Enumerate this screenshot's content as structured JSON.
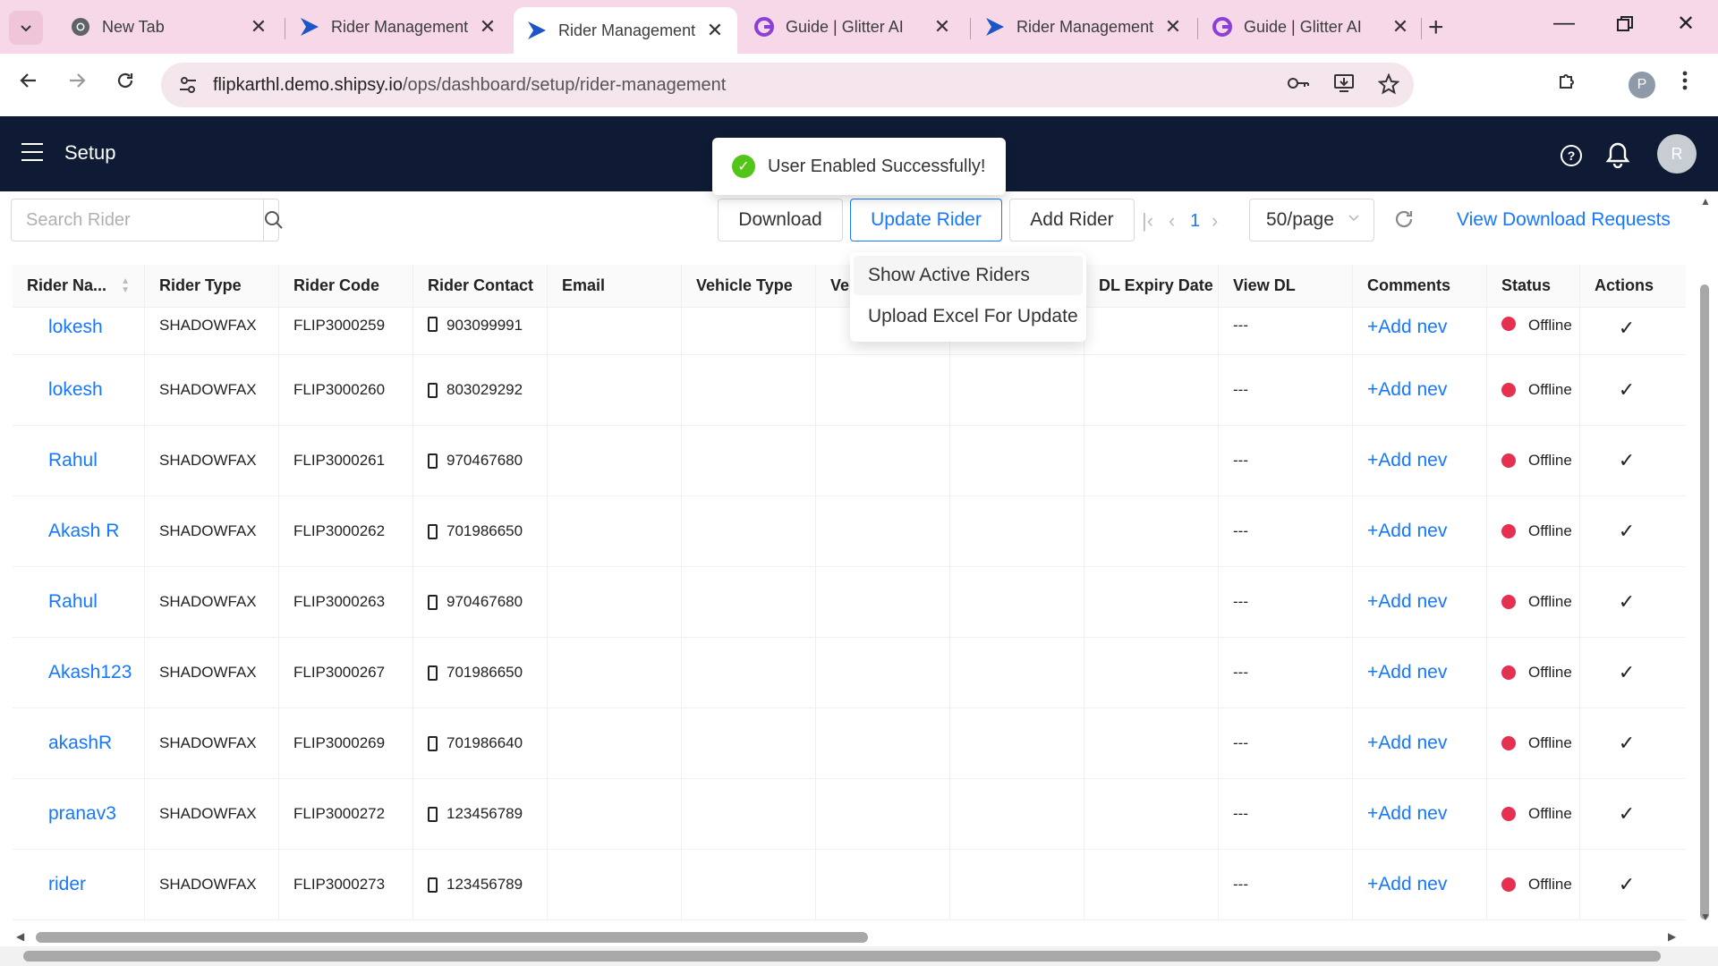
{
  "browser": {
    "tabs": [
      {
        "title": "New Tab",
        "icon": "chrome-icon",
        "active": false
      },
      {
        "title": "Rider Management",
        "icon": "shipsy-icon",
        "active": false
      },
      {
        "title": "Rider Management",
        "icon": "shipsy-icon",
        "active": true
      },
      {
        "title": "Guide | Glitter AI",
        "icon": "glitter-icon",
        "active": false
      },
      {
        "title": "Rider Management",
        "icon": "shipsy-icon",
        "active": false
      },
      {
        "title": "Guide | Glitter AI",
        "icon": "glitter-icon",
        "active": false
      }
    ],
    "url_host": "flipkarthl.demo.shipsy.io",
    "url_path": "/ops/dashboard/setup/rider-management",
    "profile_initial": "P"
  },
  "header": {
    "title": "Setup",
    "avatar_initial": "R"
  },
  "toast": {
    "message": "User Enabled Successfully!"
  },
  "toolbar": {
    "search_placeholder": "Search Rider",
    "download_label": "Download",
    "update_rider_label": "Update Rider",
    "add_rider_label": "Add Rider",
    "current_page": "1",
    "page_size": "50/page",
    "view_download_requests_label": "View Download Requests"
  },
  "dropdown": {
    "items": [
      "Show Active Riders",
      "Upload Excel For Update"
    ]
  },
  "table": {
    "columns": [
      "Rider Na...",
      "Rider Type",
      "Rider Code",
      "Rider Contact",
      "Email",
      "Vehicle Type",
      "Ve",
      "",
      "DL Expiry Date",
      "View DL",
      "Comments",
      "Status",
      "Actions"
    ],
    "rows": [
      {
        "name": "lokesh",
        "type": "SHADOWFAX",
        "code": "FLIP3000259",
        "contact": "903099991",
        "view_dl": "---",
        "comment": "+Add nev",
        "status": "Offline"
      },
      {
        "name": "lokesh",
        "type": "SHADOWFAX",
        "code": "FLIP3000260",
        "contact": "803029292",
        "view_dl": "---",
        "comment": "+Add nev",
        "status": "Offline"
      },
      {
        "name": "Rahul",
        "type": "SHADOWFAX",
        "code": "FLIP3000261",
        "contact": "970467680",
        "view_dl": "---",
        "comment": "+Add nev",
        "status": "Offline"
      },
      {
        "name": "Akash R",
        "type": "SHADOWFAX",
        "code": "FLIP3000262",
        "contact": "701986650",
        "view_dl": "---",
        "comment": "+Add nev",
        "status": "Offline"
      },
      {
        "name": "Rahul",
        "type": "SHADOWFAX",
        "code": "FLIP3000263",
        "contact": "970467680",
        "view_dl": "---",
        "comment": "+Add nev",
        "status": "Offline"
      },
      {
        "name": "Akash123",
        "type": "SHADOWFAX",
        "code": "FLIP3000267",
        "contact": "701986650",
        "view_dl": "---",
        "comment": "+Add nev",
        "status": "Offline"
      },
      {
        "name": "akashR",
        "type": "SHADOWFAX",
        "code": "FLIP3000269",
        "contact": "701986640",
        "view_dl": "---",
        "comment": "+Add nev",
        "status": "Offline"
      },
      {
        "name": "pranav3",
        "type": "SHADOWFAX",
        "code": "FLIP3000272",
        "contact": "123456789",
        "view_dl": "---",
        "comment": "+Add nev",
        "status": "Offline"
      },
      {
        "name": "rider",
        "type": "SHADOWFAX",
        "code": "FLIP3000273",
        "contact": "123456789",
        "view_dl": "---",
        "comment": "+Add nev",
        "status": "Offline"
      }
    ]
  },
  "colors": {
    "app_header": "#0f1b34",
    "accent": "#1677ff",
    "offline": "#e5304f",
    "success": "#52c41a",
    "tabstrip": "#f7d8e8"
  }
}
